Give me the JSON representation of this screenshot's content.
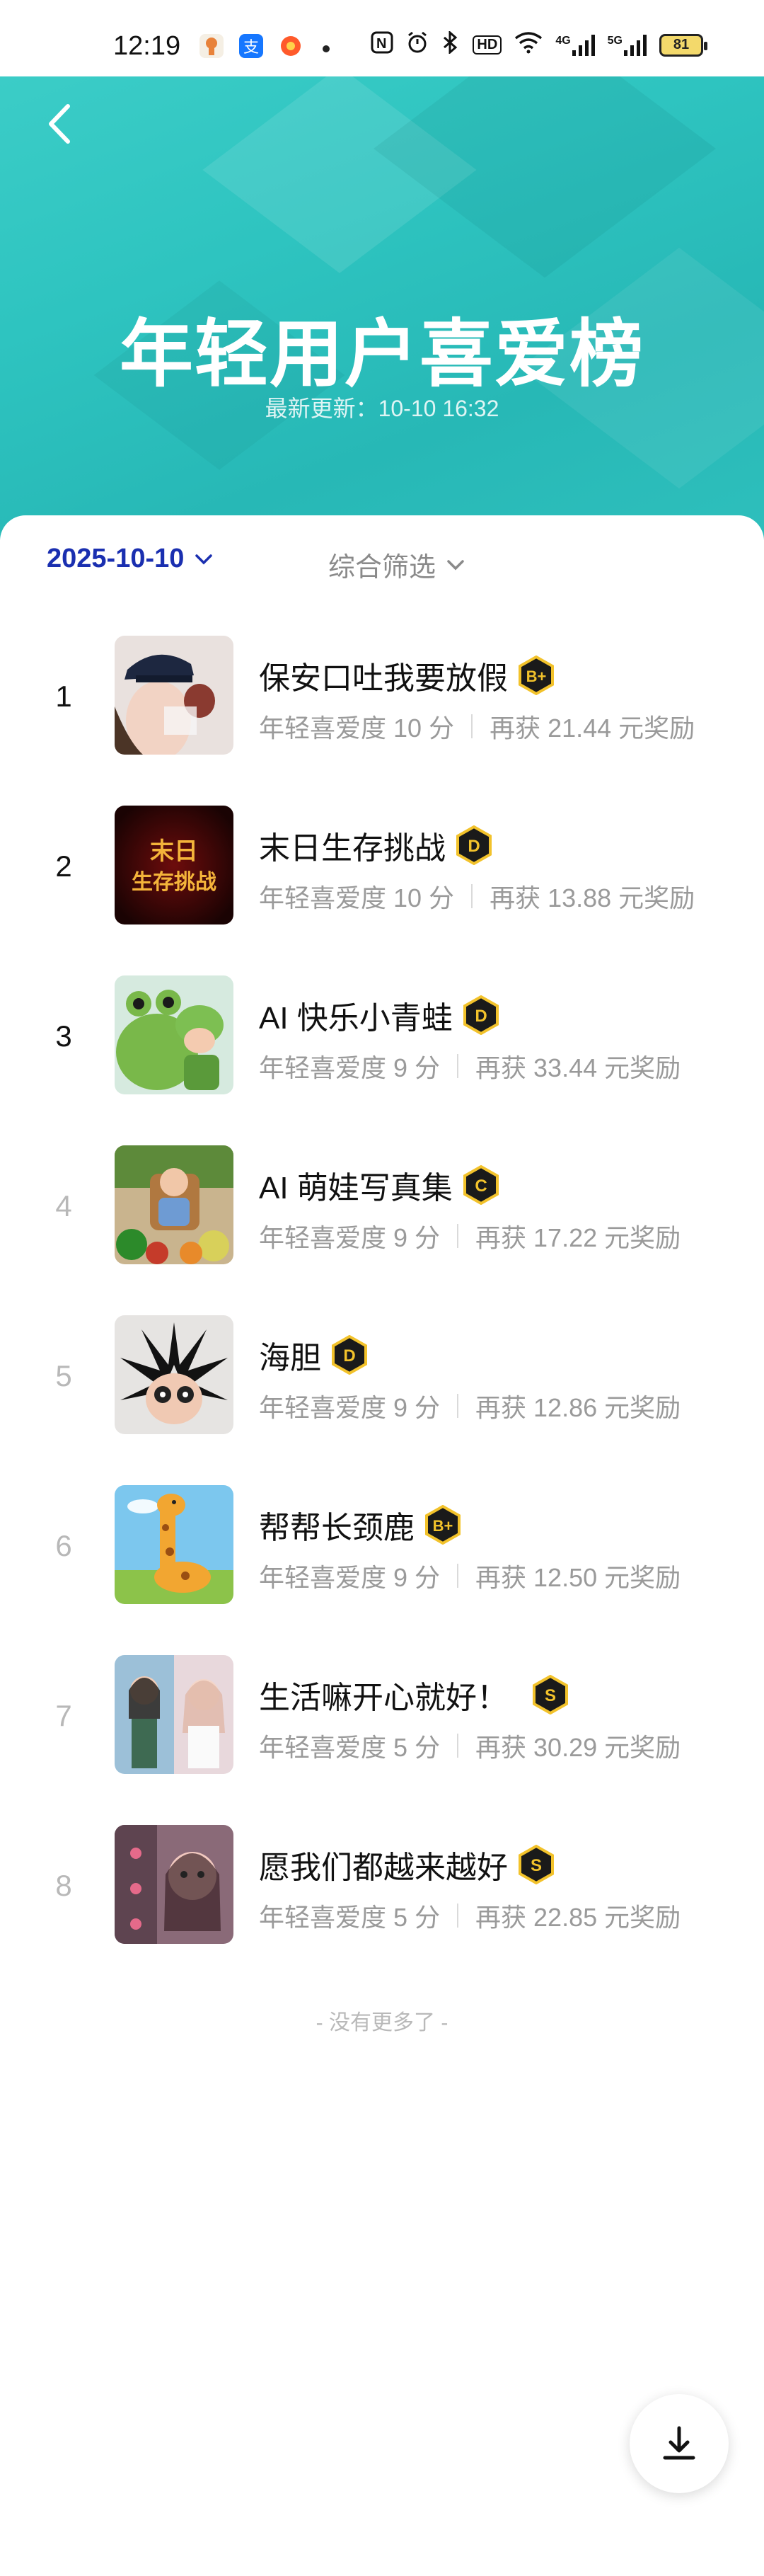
{
  "status_bar": {
    "time": "12:19",
    "hd_label": "HD",
    "net_a": "4G",
    "net_b": "5G",
    "battery": "81"
  },
  "header": {
    "title": "年轻用户喜爱榜",
    "update_text": "最新更新：10-10 16:32",
    "accent_color": "#2ec4c0"
  },
  "filters": {
    "date": "2025-10-10",
    "sort_label": "综合筛选"
  },
  "list": [
    {
      "rank": "1",
      "name": "保安口吐我要放假",
      "badge": "B+",
      "love": "年轻喜爱度 10 分",
      "reward": "再获 21.44 元奖励",
      "thumb": "girl-police-hat"
    },
    {
      "rank": "2",
      "name": "末日生存挑战",
      "badge": "D",
      "love": "年轻喜爱度 10 分",
      "reward": "再获 13.88 元奖励",
      "thumb": "doomsday-title",
      "thumb_text_1": "末日",
      "thumb_text_2": "生存挑战"
    },
    {
      "rank": "3",
      "name": "AI 快乐小青蛙",
      "badge": "D",
      "love": "年轻喜爱度 9 分",
      "reward": "再获 33.44 元奖励",
      "thumb": "frog-plush-baby"
    },
    {
      "rank": "4",
      "name": "AI 萌娃写真集",
      "badge": "C",
      "love": "年轻喜爱度 9 分",
      "reward": "再获 17.22 元奖励",
      "thumb": "baby-vegetables"
    },
    {
      "rank": "5",
      "name": "海胆",
      "badge": "D",
      "love": "年轻喜爱度 9 分",
      "reward": "再获 12.86 元奖励",
      "thumb": "sea-urchin-face"
    },
    {
      "rank": "6",
      "name": "帮帮长颈鹿",
      "badge": "B+",
      "love": "年轻喜爱度 9 分",
      "reward": "再获 12.50 元奖励",
      "thumb": "giraffe-cartoon"
    },
    {
      "rank": "7",
      "name": "生活嘛开心就好！",
      "badge": "S",
      "love": "年轻喜爱度 5 分",
      "reward": "再获 30.29 元奖励",
      "thumb": "girls-collage"
    },
    {
      "rank": "8",
      "name": "愿我们都越来越好",
      "badge": "S",
      "love": "年轻喜爱度 5 分",
      "reward": "再获 22.85 元奖励",
      "thumb": "girl-filter-collage"
    }
  ],
  "footer": {
    "no_more": "- 没有更多了 -"
  }
}
